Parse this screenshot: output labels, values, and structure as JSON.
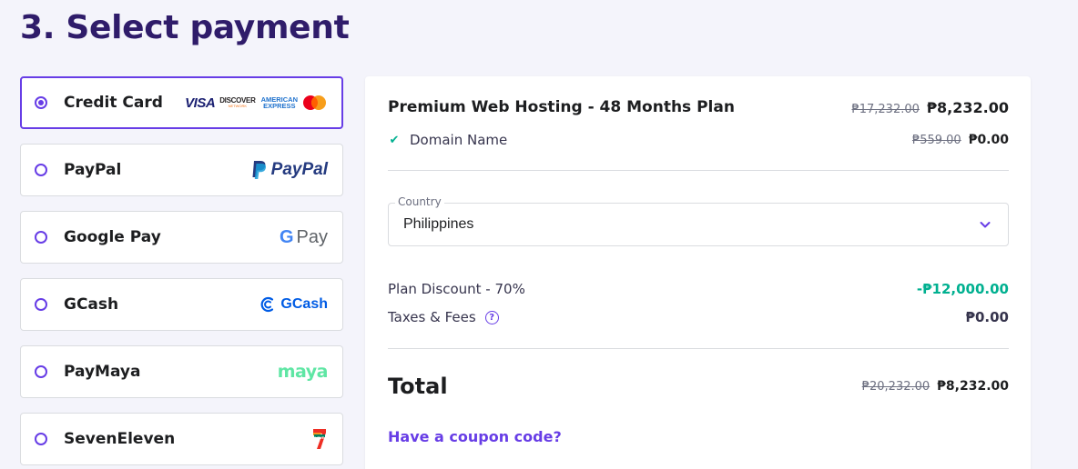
{
  "page": {
    "title": "3. Select payment"
  },
  "payment_methods": [
    {
      "label": "Credit Card",
      "selected": true
    },
    {
      "label": "PayPal",
      "selected": false
    },
    {
      "label": "Google Pay",
      "selected": false
    },
    {
      "label": "GCash",
      "selected": false
    },
    {
      "label": "PayMaya",
      "selected": false
    },
    {
      "label": "SevenEleven",
      "selected": false
    }
  ],
  "logos": {
    "visa": "VISA",
    "discover": "DISCOVER",
    "discover_sub": "NETWORK",
    "amex_1": "AMERICAN",
    "amex_2": "EXPRESS",
    "paypal": "PayPal",
    "gpay_g": "G",
    "gpay_pay": "Pay",
    "gcash": "GCash",
    "maya": "maya",
    "seven_sub": "ELEVEn"
  },
  "summary": {
    "plan_name": "Premium Web Hosting - 48 Months Plan",
    "plan_old_price": "₱17,232.00",
    "plan_new_price": "₱8,232.00",
    "domain_label": "Domain Name",
    "domain_old_price": "₱559.00",
    "domain_new_price": "₱0.00",
    "country_legend": "Country",
    "country_value": "Philippines",
    "discount_label": "Plan Discount - 70%",
    "discount_value": "-₱12,000.00",
    "taxes_label": "Taxes & Fees",
    "taxes_value": "₱0.00",
    "help_glyph": "?",
    "total_label": "Total",
    "total_old": "₱20,232.00",
    "total_new": "₱8,232.00",
    "coupon_link": "Have a coupon code?"
  },
  "colors": {
    "accent": "#673de6",
    "title": "#2f1c6a",
    "success": "#00b090",
    "background": "#f4f4fb"
  }
}
